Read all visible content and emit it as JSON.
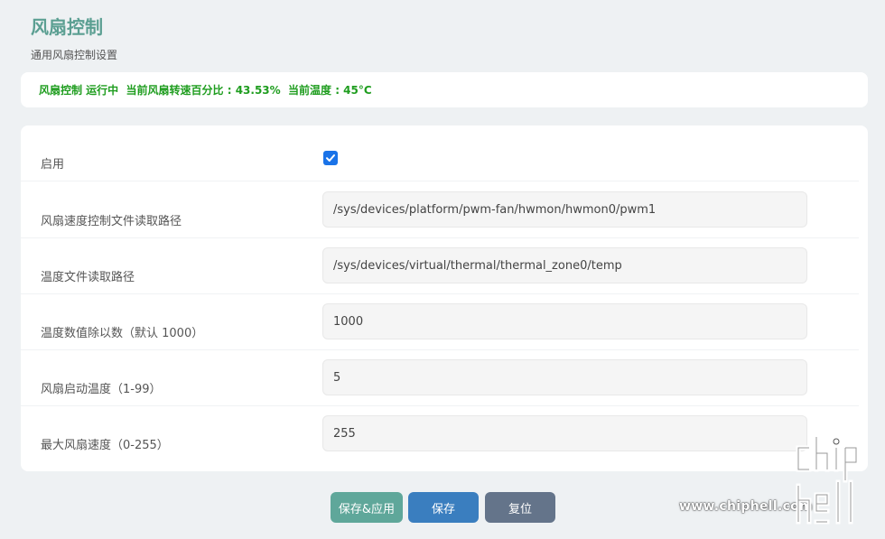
{
  "page": {
    "title": "风扇控制",
    "subtitle": "通用风扇控制设置"
  },
  "status": {
    "text": "风扇控制 运行中  当前风扇转速百分比 : 43.53%  当前温度 : 45°C"
  },
  "form": {
    "enable": {
      "label": "启用",
      "checked": true
    },
    "speed_path": {
      "label": "风扇速度控制文件读取路径",
      "value": "/sys/devices/platform/pwm-fan/hwmon/hwmon0/pwm1"
    },
    "temp_path": {
      "label": "温度文件读取路径",
      "value": "/sys/devices/virtual/thermal/thermal_zone0/temp"
    },
    "temp_div": {
      "label": "温度数值除以数（默认 1000）",
      "value": "1000"
    },
    "start_temp": {
      "label": "风扇启动温度（1-99）",
      "value": "5"
    },
    "max_speed": {
      "label": "最大风扇速度（0-255）",
      "value": "255"
    }
  },
  "actions": {
    "save_apply": "保存&应用",
    "save": "保存",
    "reset": "复位"
  },
  "watermark": {
    "site": "www.chiphell.com",
    "logo": "chip hell"
  },
  "colors": {
    "title": "#5b9f92",
    "status": "#1f9d1f",
    "save_apply": "#5fa79a",
    "save": "#3a7ebf",
    "reset": "#64748a",
    "checkbox": "#1a73e8"
  }
}
